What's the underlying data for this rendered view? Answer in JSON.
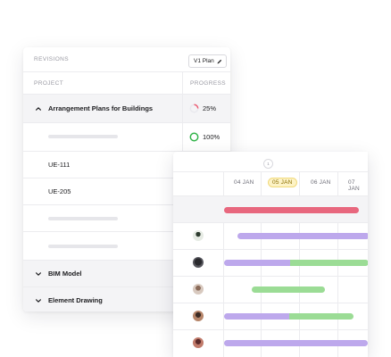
{
  "revisions": {
    "label": "REVISIONS",
    "plan": "V1 Plan"
  },
  "table": {
    "col_project": "PROJECT",
    "col_progress": "PROGRESS",
    "group1_title": "Arrangement Plans for Buildings",
    "group1_progress": "25%",
    "row2_progress": "100%",
    "item_ue111": "UE-111",
    "item_ue205": "UE-205",
    "group2_title": "BIM Model",
    "group3_title": "Element Drawing"
  },
  "timeline": {
    "week_marker": "1",
    "dates": [
      "04 JAN",
      "05 JAN",
      "06 JAN",
      "07 JAN"
    ],
    "today_index": 1
  },
  "progress_values": {
    "group1": 0.25,
    "row2": 1.0
  },
  "colors": {
    "red_bar": "#e8677e",
    "purple_bar": "#bda8ec",
    "green_bar": "#9bdc95",
    "progress_red": "#ec5b72",
    "progress_green": "#33b54a",
    "today_badge": "#fdf3c6"
  },
  "icons": {
    "edit": "pencil-icon",
    "expanded": "chevron-up-icon",
    "collapsed": "chevron-down-icon",
    "avatar": "user-avatar"
  }
}
